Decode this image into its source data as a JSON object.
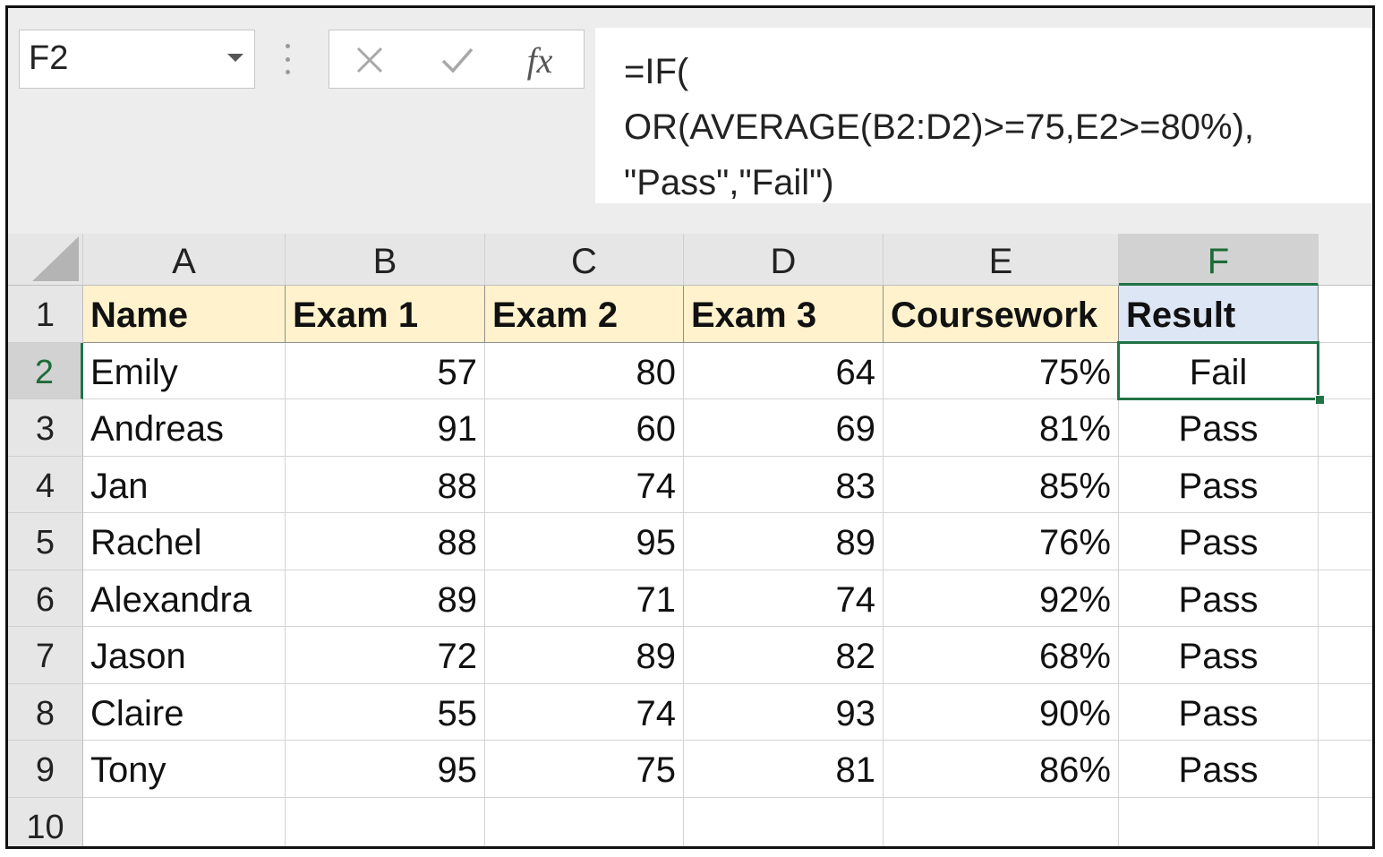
{
  "name_box": {
    "value": "F2"
  },
  "formula_bar": {
    "cancel_icon": "close-icon",
    "enter_icon": "check-icon",
    "fx_label": "fx",
    "lines": [
      "=IF(",
      "OR(AVERAGE(B2:D2)>=75,E2>=80%),",
      "\"Pass\",\"Fail\")"
    ]
  },
  "sheet": {
    "columns": [
      "A",
      "B",
      "C",
      "D",
      "E",
      "F"
    ],
    "selected_column": "F",
    "selected_row": "2",
    "rows": [
      {
        "num": "1",
        "cells": [
          "Name",
          "Exam 1",
          "Exam 2",
          "Exam 3",
          "Coursework",
          "Result"
        ]
      },
      {
        "num": "2",
        "cells": [
          "Emily",
          "57",
          "80",
          "64",
          "75%",
          "Fail"
        ]
      },
      {
        "num": "3",
        "cells": [
          "Andreas",
          "91",
          "60",
          "69",
          "81%",
          "Pass"
        ]
      },
      {
        "num": "4",
        "cells": [
          "Jan",
          "88",
          "74",
          "83",
          "85%",
          "Pass"
        ]
      },
      {
        "num": "5",
        "cells": [
          "Rachel",
          "88",
          "95",
          "89",
          "76%",
          "Pass"
        ]
      },
      {
        "num": "6",
        "cells": [
          "Alexandra",
          "89",
          "71",
          "74",
          "92%",
          "Pass"
        ]
      },
      {
        "num": "7",
        "cells": [
          "Jason",
          "72",
          "89",
          "82",
          "68%",
          "Pass"
        ]
      },
      {
        "num": "8",
        "cells": [
          "Claire",
          "55",
          "74",
          "93",
          "90%",
          "Pass"
        ]
      },
      {
        "num": "9",
        "cells": [
          "Tony",
          "95",
          "75",
          "81",
          "86%",
          "Pass"
        ]
      },
      {
        "num": "10",
        "cells": [
          "",
          "",
          "",
          "",
          "",
          ""
        ]
      }
    ]
  },
  "colors": {
    "header_fill": "#fff2cc",
    "result_header_fill": "#dde6f5",
    "selection_green": "#217346"
  }
}
